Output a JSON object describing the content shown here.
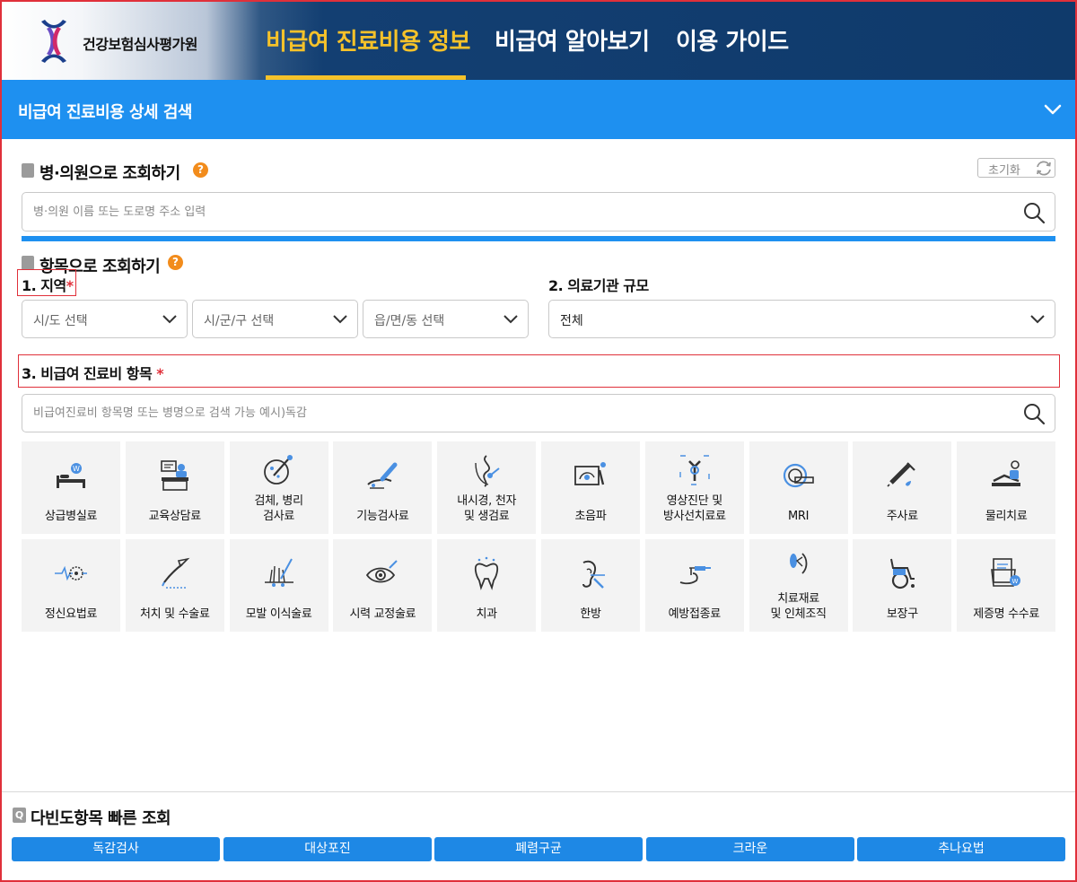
{
  "header": {
    "brand": "건강보험심사평가원",
    "nav": [
      {
        "label": "비급여 진료비용 정보",
        "active": true
      },
      {
        "label": "비급여 알아보기",
        "active": false
      },
      {
        "label": "이용 가이드",
        "active": false
      }
    ]
  },
  "detail_bar": {
    "title": "비급여 진료비용 상세 검색",
    "icon": "chevron-down-icon"
  },
  "hospital_search": {
    "title": "병·의원으로 조회하기",
    "help": "?",
    "reset_label": "초기화",
    "placeholder": "병·의원 이름 또는 도로명 주소 입력"
  },
  "item_search": {
    "title": "항목으로 조회하기",
    "help": "?",
    "region": {
      "label": "1. 지역",
      "required": "*",
      "selects": [
        "시/도 선택",
        "시/군/구 선택",
        "읍/면/동 선택"
      ]
    },
    "scale": {
      "label": "2. 의료기관 규모",
      "value": "전체"
    },
    "category": {
      "label": "3. 비급여 진료비 항목",
      "required": "*",
      "placeholder": "비급여진료비 항목명 또는 병명으로 검색 가능 예시)독감"
    }
  },
  "categories": [
    {
      "label": "상급병실료",
      "icon": "hospital-bed-icon"
    },
    {
      "label": "교육상담료",
      "icon": "counseling-desk-icon"
    },
    {
      "label": "검체, 병리\n검사료",
      "icon": "specimen-test-icon"
    },
    {
      "label": "기능검사료",
      "icon": "function-test-icon"
    },
    {
      "label": "내시경, 천자\n및 생검료",
      "icon": "endoscope-icon"
    },
    {
      "label": "초음파",
      "icon": "ultrasound-icon"
    },
    {
      "label": "영상진단 및\n방사선치료료",
      "icon": "radiology-icon"
    },
    {
      "label": "MRI",
      "icon": "mri-icon"
    },
    {
      "label": "주사료",
      "icon": "syringe-icon"
    },
    {
      "label": "물리치료",
      "icon": "physical-therapy-icon"
    },
    {
      "label": "정신요법료",
      "icon": "brain-wave-icon"
    },
    {
      "label": "처치 및 수술료",
      "icon": "surgery-icon"
    },
    {
      "label": "모발 이식술료",
      "icon": "hair-transplant-icon"
    },
    {
      "label": "시력 교정술료",
      "icon": "eye-laser-icon"
    },
    {
      "label": "치과",
      "icon": "tooth-icon"
    },
    {
      "label": "한방",
      "icon": "acupuncture-icon"
    },
    {
      "label": "예방접종료",
      "icon": "vaccination-icon"
    },
    {
      "label": "치료재료\n및 인체조직",
      "icon": "lens-material-icon"
    },
    {
      "label": "보장구",
      "icon": "wheelchair-icon"
    },
    {
      "label": "제증명 수수료",
      "icon": "certificate-icon"
    }
  ],
  "quick_lookup": {
    "title": "다빈도항목 빠른 조회",
    "icon_letter": "Q",
    "buttons": [
      "독감검사",
      "대상포진",
      "폐렴구균",
      "크라운",
      "추나요법"
    ]
  },
  "colors": {
    "accent_blue": "#1e90f0",
    "nav_active": "#f5c22a",
    "header_navy": "#0f3a6b",
    "required_red": "#e0303a",
    "help_orange": "#f28c1c"
  }
}
